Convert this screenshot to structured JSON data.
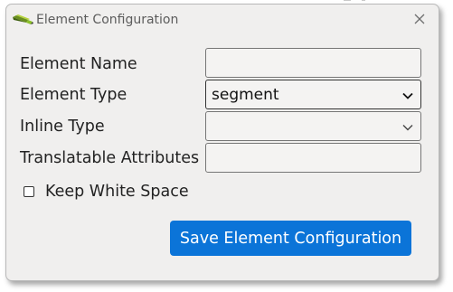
{
  "window": {
    "title": "Element Configuration",
    "icon": "pencil-icon",
    "close_icon": "close-icon"
  },
  "form": {
    "element_name": {
      "label": "Element Name",
      "value": ""
    },
    "element_type": {
      "label": "Element Type",
      "value": "segment"
    },
    "inline_type": {
      "label": "Inline Type",
      "value": ""
    },
    "translatable_attributes": {
      "label": "Translatable Attributes",
      "value": ""
    },
    "keep_white_space": {
      "label": "Keep White Space",
      "checked": false
    },
    "save_label": "Save Element Configuration"
  },
  "colors": {
    "accent": "#0b74d8",
    "window_bg": "#f0efee"
  }
}
